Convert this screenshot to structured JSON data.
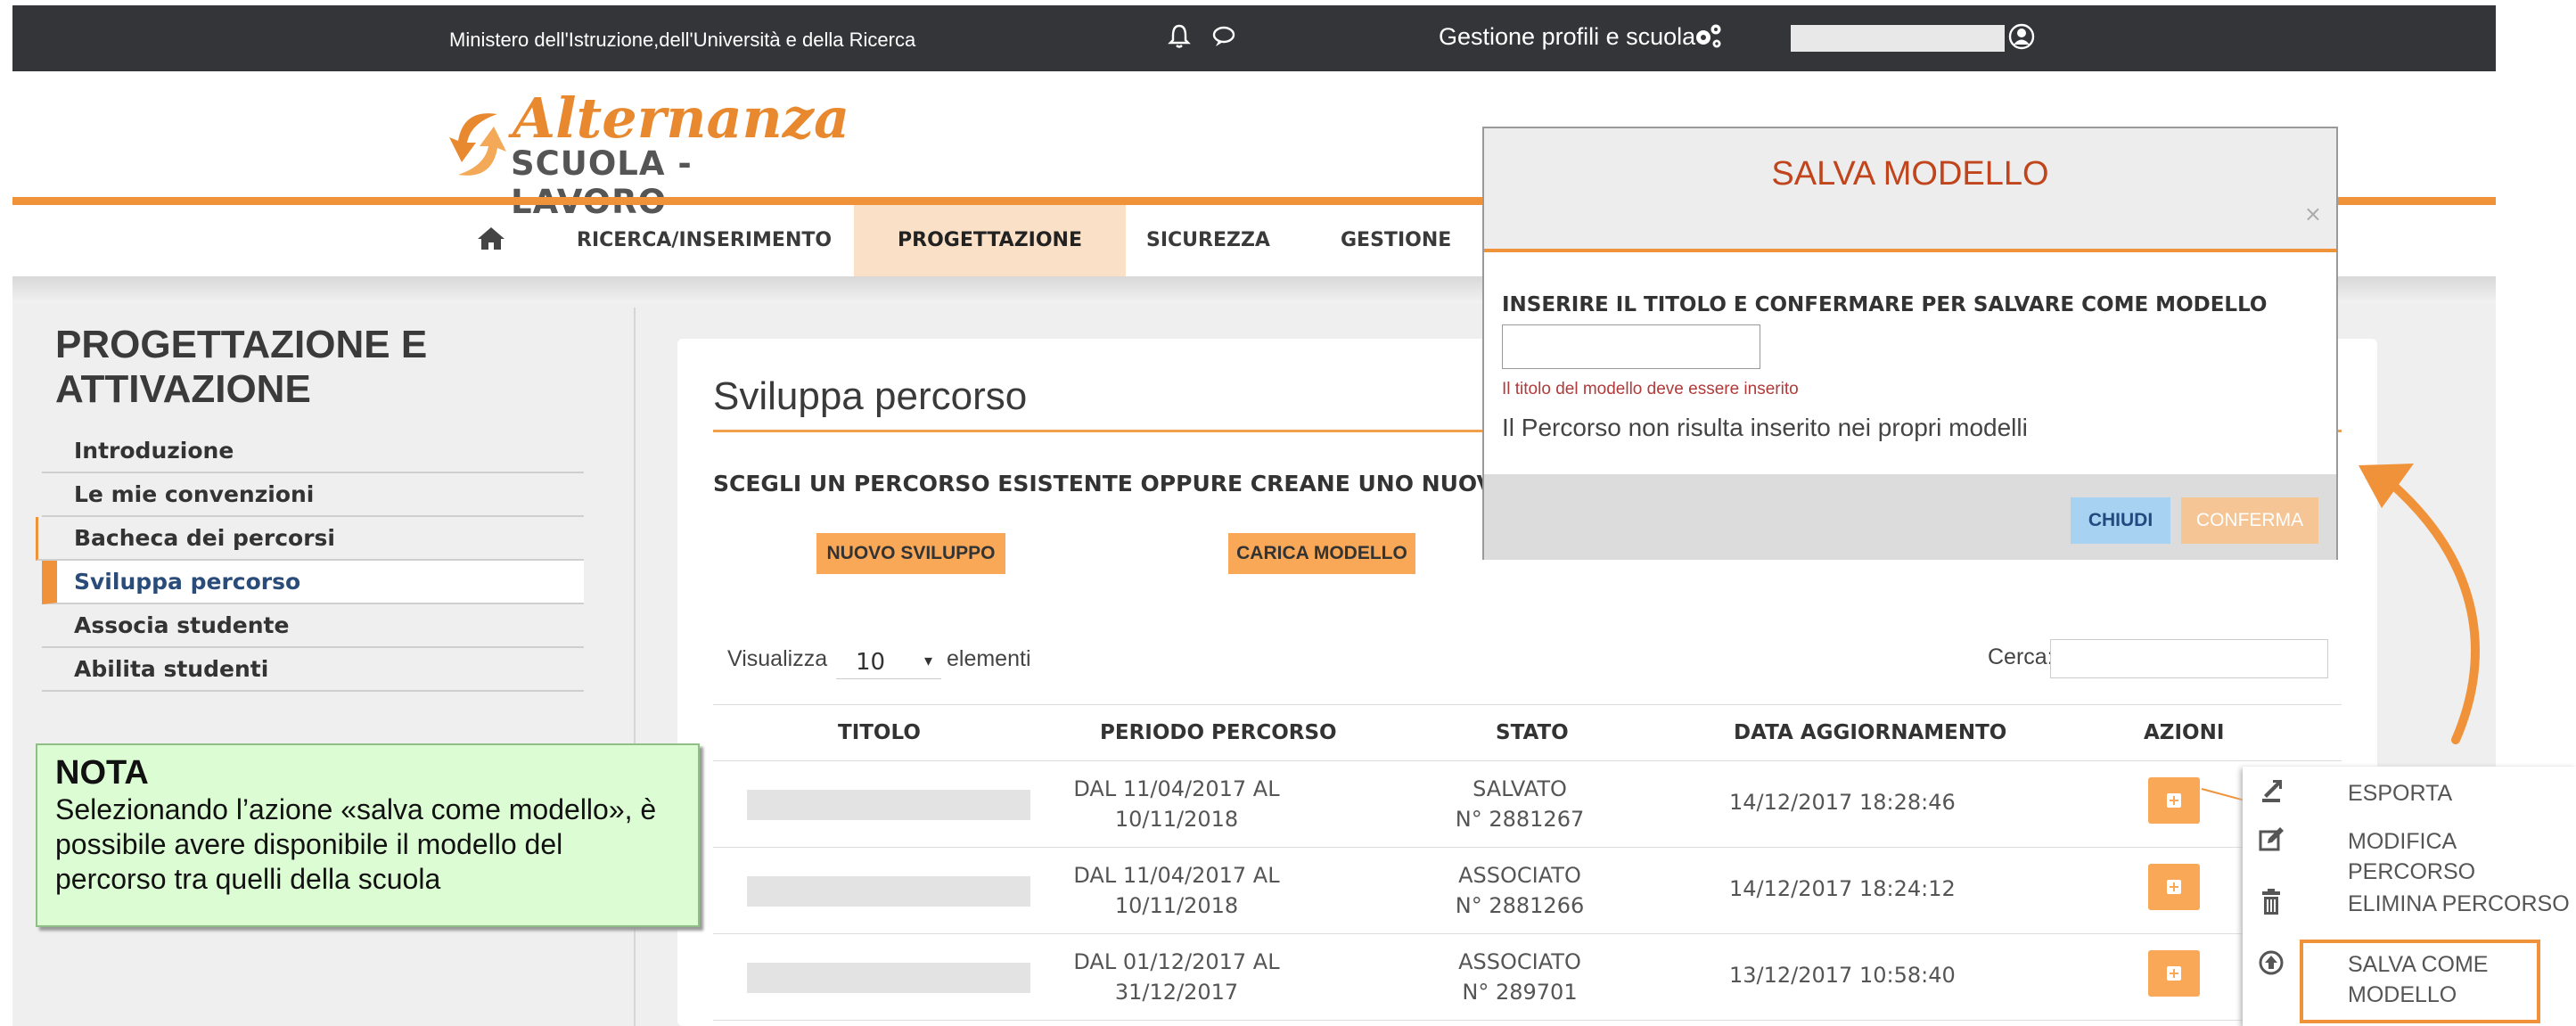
{
  "topbar": {
    "ministry": "Ministero dell'Istruzione,dell'Università e della Ricerca",
    "profiles": "Gestione profili e scuola"
  },
  "logo": {
    "title": "Alternanza",
    "subtitle": "SCUOLA - LAVORO"
  },
  "nav": {
    "items": [
      {
        "label": "RICERCA/INSERIMENTO"
      },
      {
        "label": "PROGETTAZIONE"
      },
      {
        "label": "SICUREZZA"
      },
      {
        "label": "GESTIONE"
      }
    ]
  },
  "sidebar": {
    "title": "PROGETTAZIONE E ATTIVAZIONE",
    "items": [
      {
        "label": "Introduzione"
      },
      {
        "label": "Le mie convenzioni"
      },
      {
        "label": "Bacheca dei percorsi"
      },
      {
        "label": "Sviluppa percorso"
      },
      {
        "label": "Associa studente"
      },
      {
        "label": "Abilita studenti"
      }
    ]
  },
  "nota": {
    "title": "NOTA",
    "body": "Selezionando l’azione «salva come modello», è possibile avere disponibile il modello del percorso tra quelli della scuola"
  },
  "main": {
    "title": "Sviluppa percorso",
    "choose": "SCEGLI UN PERCORSO ESISTENTE OPPURE CREANE UNO NUOVO",
    "btn_new": "NUOVO SVILUPPO",
    "btn_load": "CARICA MODELLO",
    "show_label": "Visualizza",
    "show_value": "10",
    "show_suffix": "elementi",
    "search_label": "Cerca:",
    "columns": [
      "TITOLO",
      "PERIODO PERCORSO",
      "STATO",
      "DATA AGGIORNAMENTO",
      "AZIONI"
    ],
    "rows": [
      {
        "period1": "DAL  11/04/2017 AL",
        "period2": "10/11/2018",
        "state1": "SALVATO",
        "state2": "N° 2881267",
        "date": "14/12/2017 18:28:46"
      },
      {
        "period1": "DAL  11/04/2017 AL",
        "period2": "10/11/2018",
        "state1": "ASSOCIATO",
        "state2": "N° 2881266",
        "date": "14/12/2017 18:24:12"
      },
      {
        "period1": "DAL  01/12/2017 AL",
        "period2": "31/12/2017",
        "state1": "ASSOCIATO",
        "state2": "N° 289701",
        "date": "13/12/2017 10:58:40"
      }
    ]
  },
  "modal": {
    "title": "SALVA MODELLO",
    "close": "×",
    "label": "INSERIRE IL TITOLO E CONFERMARE PER SALVARE COME MODELLO",
    "error": "Il titolo del modello deve essere inserito",
    "info": "Il Percorso non risulta inserito nei propri modelli",
    "btn_close": "CHIUDI",
    "btn_confirm": "CONFERMA"
  },
  "actions_menu": {
    "items": [
      {
        "label": "ESPORTA",
        "icon": "export-icon"
      },
      {
        "label": "MODIFICA PERCORSO",
        "icon": "edit-icon"
      },
      {
        "label": "ELIMINA PERCORSO",
        "icon": "trash-icon"
      },
      {
        "label": "SALVA COME MODELLO",
        "icon": "upload-circle-icon"
      }
    ]
  },
  "colors": {
    "accent": "#f0923a",
    "topbar": "#343538",
    "modal_title": "#c0441c",
    "nota_bg": "#dcfcd4"
  }
}
